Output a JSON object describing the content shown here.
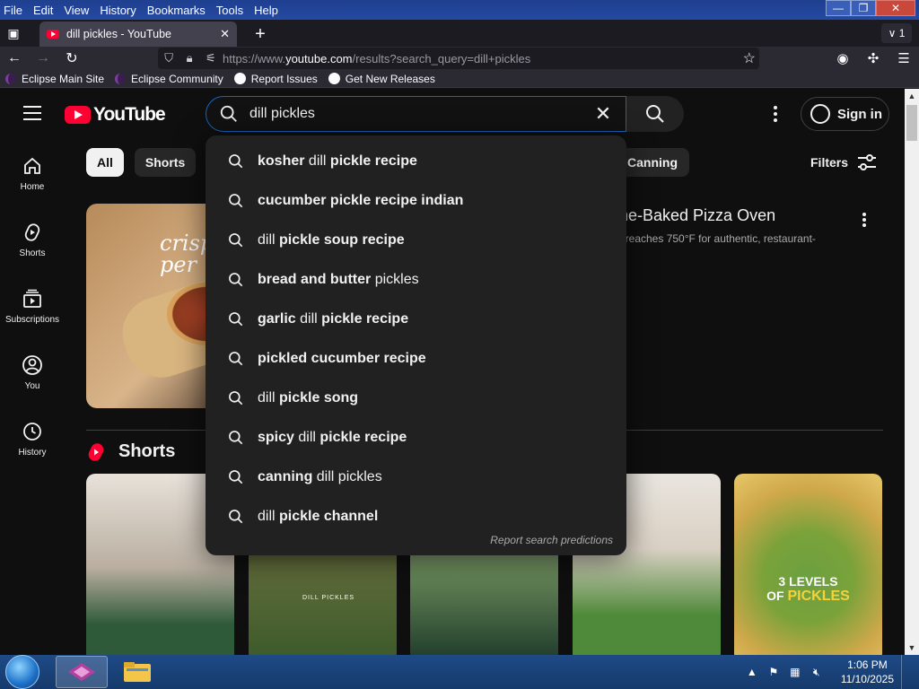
{
  "browser": {
    "menu": [
      "File",
      "Edit",
      "View",
      "History",
      "Bookmarks",
      "Tools",
      "Help"
    ],
    "window_controls": {
      "minimize": "—",
      "restore": "❐",
      "close": "✕"
    },
    "tab": {
      "title": "dill pickles - YouTube",
      "close": "✕"
    },
    "new_tab": "+",
    "tab_count": "∨ 1",
    "url_prefix": "https://www.",
    "url_domain": "youtube.com",
    "url_rest": "/results?search_query=dill+pickles",
    "bookmarks": [
      {
        "label": "Eclipse Main Site",
        "icon": "eclipse-icon"
      },
      {
        "label": "Eclipse Community",
        "icon": "eclipse-icon"
      },
      {
        "label": "Report Issues",
        "icon": "github-icon"
      },
      {
        "label": "Get New Releases",
        "icon": "github-icon"
      }
    ]
  },
  "youtube": {
    "logo": "YouTube",
    "search": {
      "value": "dill pickles",
      "clear": "✕"
    },
    "sign_in": "Sign in",
    "guide": [
      {
        "label": "Home",
        "icon": "home-icon"
      },
      {
        "label": "Shorts",
        "icon": "shorts-icon"
      },
      {
        "label": "Subscriptions",
        "icon": "subscriptions-icon"
      },
      {
        "label": "You",
        "icon": "you-icon"
      },
      {
        "label": "History",
        "icon": "history-icon"
      }
    ],
    "chips": [
      "All",
      "Shorts"
    ],
    "chip_right": "Canning",
    "filters": "Filters",
    "video": {
      "title": "ne-Baked Pizza Oven",
      "description": "t reaches 750°F for authentic, restaurant-",
      "thumb_text": "crisp\nper"
    },
    "shorts_heading": "Shorts",
    "shorts_thumbs": [
      {
        "overlay": ""
      },
      {
        "overlay": "DILL PICKLES"
      },
      {
        "overlay": ""
      },
      {
        "overlay": ""
      },
      {
        "overlay_line1": "3 LEVELS",
        "overlay_pre": "OF ",
        "overlay_word": "PICKLES"
      }
    ],
    "suggestions": [
      {
        "bold_a": "kosher ",
        "plain": "dill",
        "bold_b": " pickle recipe"
      },
      {
        "bold_a": "cucumber pickle recipe indian",
        "plain": "",
        "bold_b": ""
      },
      {
        "bold_a": "",
        "plain": "dill",
        "bold_b": " pickle soup recipe"
      },
      {
        "bold_a": "bread and butter ",
        "plain": "pickles",
        "bold_b": ""
      },
      {
        "bold_a": "garlic ",
        "plain": "dill",
        "bold_b": " pickle recipe"
      },
      {
        "bold_a": "pickled cucumber recipe",
        "plain": "",
        "bold_b": ""
      },
      {
        "bold_a": "",
        "plain": "dill",
        "bold_b": " pickle song"
      },
      {
        "bold_a": "spicy ",
        "plain": "dill",
        "bold_b": " pickle recipe"
      },
      {
        "bold_a": "canning ",
        "plain": "dill pickles",
        "bold_b": ""
      },
      {
        "bold_a": "",
        "plain": "dill",
        "bold_b": " pickle channel"
      }
    ],
    "report": "Report search predictions"
  },
  "taskbar": {
    "time": "1:06 PM",
    "date": "11/10/2025"
  },
  "colors": {
    "accent": "#ff0033",
    "search_border": "#1c62b9",
    "page_bg": "#0f0f0f"
  }
}
